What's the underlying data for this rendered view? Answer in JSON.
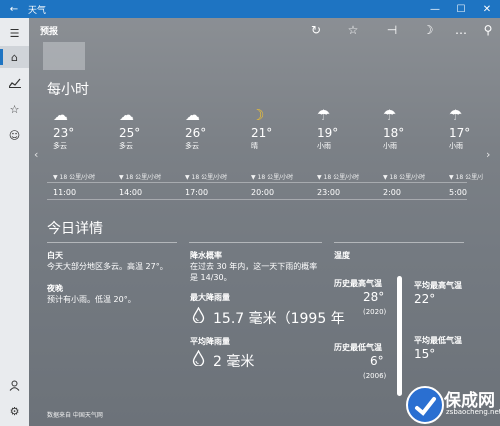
{
  "window": {
    "title": "天气",
    "back_icon": "←",
    "minimize": "—",
    "maximize": "☐",
    "close": "✕"
  },
  "rail": {
    "items": [
      {
        "name": "menu-icon",
        "glyph": "☰"
      },
      {
        "name": "home-icon",
        "glyph": "⌂"
      },
      {
        "name": "chart-icon",
        "glyph": "📈"
      },
      {
        "name": "favorites-icon",
        "glyph": "☆"
      },
      {
        "name": "smiley-icon",
        "glyph": "☺"
      }
    ],
    "bottom": [
      {
        "name": "person-icon",
        "glyph": "👤"
      },
      {
        "name": "settings-icon",
        "glyph": "⚙"
      }
    ]
  },
  "toolbar": {
    "page_name": "预报",
    "refresh": "↻",
    "favorite": "☆",
    "pin": "⊣",
    "darkmode": "☽",
    "more": "…",
    "search": "⚲"
  },
  "hourly": {
    "title": "每小时",
    "prev_icon": "‹",
    "next_icon": "›",
    "hours": [
      {
        "time": "11:00",
        "temp": "23°",
        "cond": "多云",
        "wind": "▼ 18 公里/小时",
        "icon": "☁"
      },
      {
        "time": "14:00",
        "temp": "25°",
        "cond": "多云",
        "wind": "▼ 18 公里/小时",
        "icon": "☁"
      },
      {
        "time": "17:00",
        "temp": "26°",
        "cond": "多云",
        "wind": "▼ 18 公里/小时",
        "icon": "☁"
      },
      {
        "time": "20:00",
        "temp": "21°",
        "cond": "晴",
        "wind": "▼ 18 公里/小时",
        "icon": "☽"
      },
      {
        "time": "23:00",
        "temp": "19°",
        "cond": "小雨",
        "wind": "▼ 18 公里/小时",
        "icon": "☂"
      },
      {
        "time": "2:00",
        "temp": "18°",
        "cond": "小雨",
        "wind": "▼ 18 公里/小时",
        "icon": "☂"
      },
      {
        "time": "5:00",
        "temp": "17°",
        "cond": "小雨",
        "wind": "▼ 18 公里/小时",
        "icon": "☂"
      }
    ]
  },
  "details": {
    "title": "今日详情",
    "day_label": "白天",
    "day_text": "今天大部分地区多云。高温 27°。",
    "night_label": "夜晚",
    "night_text": "预计有小雨。低温 20°。",
    "rain_prob_label": "降水概率",
    "rain_prob_text_1": "在过去 30 年内，这一天下雨的概率",
    "rain_prob_text_2": "是 14/30。",
    "max_rain_label": "最大降雨量",
    "max_rain_value": "15.7 毫米（1995 年",
    "avg_rain_label": "平均降雨量",
    "avg_rain_value": "2 毫米",
    "temp_label": "温度",
    "hist_high_label": "历史最高气温",
    "hist_high_value": "28°",
    "hist_high_year": "(2020)",
    "avg_high_label": "平均最高气温",
    "avg_high_value": "22°",
    "hist_low_label": "历史最低气温",
    "hist_low_value": "6°",
    "hist_low_year": "(2006)",
    "avg_low_label": "平均最低气温",
    "avg_low_value": "15°"
  },
  "footer": {
    "source": "数据来自 中国天气网"
  },
  "watermark": {
    "name": "保成网",
    "url": "zsbaocheng.net"
  }
}
